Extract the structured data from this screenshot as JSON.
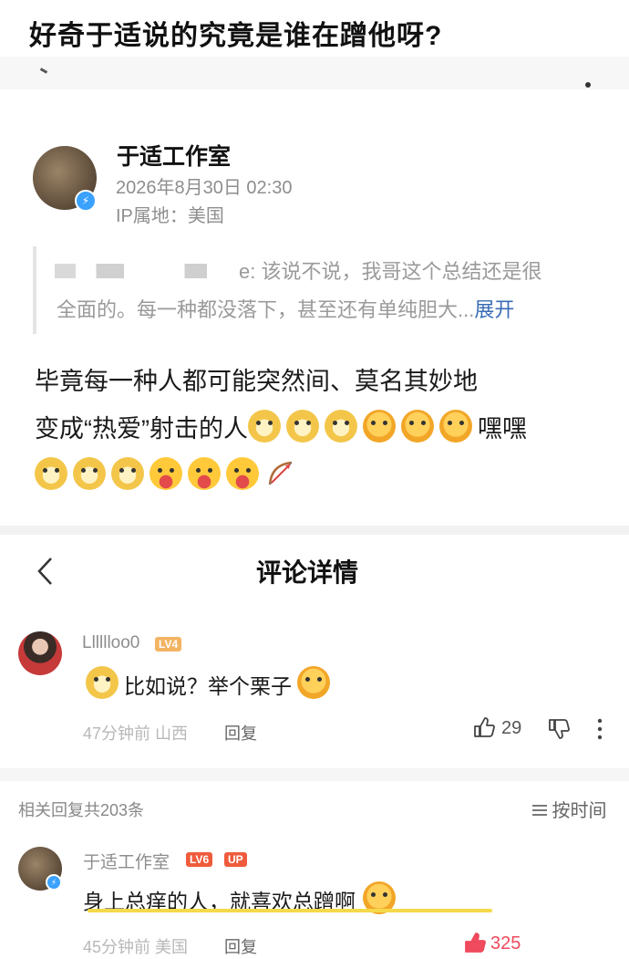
{
  "headline": "好奇于适说的究竟是谁在蹭他呀?",
  "post": {
    "author": "于适工作室",
    "date": "2026年8月30日 02:30",
    "ip": "IP属地：美国",
    "quote_text": "e: 该说不说，我哥这个总结还是很",
    "quote_text2": "全面的。每一种都没落下，甚至还有单纯胆大...",
    "expand": "展开",
    "body_line1": "毕竟每一种人都可能突然间、莫名其妙地",
    "body_line2": "变成“热爱”射击的人",
    "body_hehe": "嘿嘿",
    "emojis_line2": [
      "dog",
      "dog",
      "dog",
      "cover",
      "cover",
      "cover"
    ],
    "emojis_line3": [
      "dog",
      "dog",
      "dog",
      "tongue",
      "tongue",
      "tongue",
      "arrow"
    ]
  },
  "nav": {
    "back": "<",
    "title": "评论详情"
  },
  "main_comment": {
    "user": "Lllllloo0",
    "level": "LV4",
    "text": "比如说？举个栗子",
    "time_loc": "47分钟前 山西",
    "reply": "回复",
    "likes": "29"
  },
  "replies_bar": {
    "summary": "相关回复共203条",
    "sort": "按时间"
  },
  "reply_comment": {
    "user": "于适工作室",
    "level": "LV6",
    "up": "UP",
    "text": "身上总痒的人，就喜欢总蹭啊",
    "time_loc": "45分钟前 美国",
    "reply": "回复",
    "likes": "325"
  },
  "colors": {
    "level4": "#f2b463",
    "level6": "#ef5b3c",
    "up": "#ef5b3c",
    "link": "#3a6db5",
    "underline": "#f5d94a"
  }
}
